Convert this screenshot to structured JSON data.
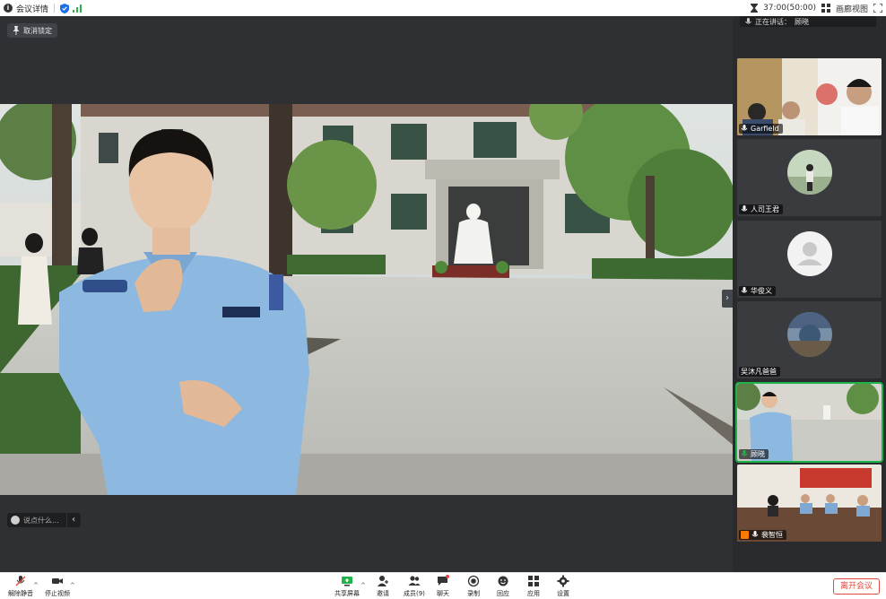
{
  "topbar": {
    "meeting_details": "会议详情",
    "time": "37:00(50:00)",
    "view_label": "画廊视图"
  },
  "stage": {
    "unpin_label": "取消锁定",
    "chat_placeholder": "说点什么...",
    "chevron": "‹",
    "sidebar_toggle": "›"
  },
  "panel": {
    "speaking_label": "正在讲话：",
    "speaking_name": "顾晓",
    "participants": [
      {
        "name": "Garfield",
        "mic": "unmuted"
      },
      {
        "name": "人司王君",
        "mic": "unmuted"
      },
      {
        "name": "华俊义",
        "mic": "unmuted"
      },
      {
        "name": "吴沐凡爸爸",
        "mic": "none"
      },
      {
        "name": "顾晓",
        "mic": "speaking"
      },
      {
        "name": "裴智恒",
        "mic": "muted"
      }
    ]
  },
  "toolbar": {
    "unmute": "解除静音",
    "stop_video": "停止视频",
    "share_screen": "共享屏幕",
    "invite": "邀请",
    "members": "成员(9)",
    "chat": "聊天",
    "record": "录制",
    "reactions": "回应",
    "apps": "应用",
    "settings": "设置",
    "leave": "离开会议"
  },
  "colors": {
    "accent_green": "#1fb44a",
    "leave_red": "#e2483d",
    "stage_bg": "#2e3033"
  }
}
